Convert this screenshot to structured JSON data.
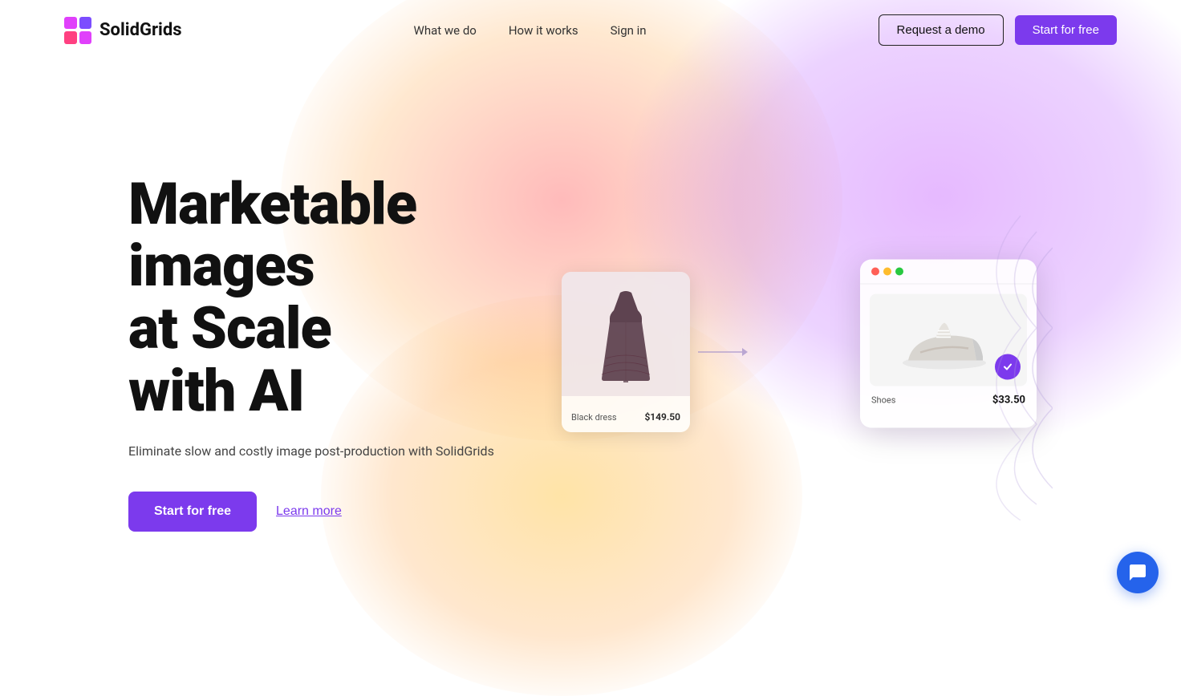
{
  "nav": {
    "logo_text_bold": "Solid",
    "logo_text_light": "Grids",
    "links": [
      {
        "id": "what-we-do",
        "label": "What we do"
      },
      {
        "id": "how-it-works",
        "label": "How it works"
      },
      {
        "id": "sign-in",
        "label": "Sign in"
      }
    ],
    "btn_demo": "Request a demo",
    "btn_start": "Start for free"
  },
  "hero": {
    "title_line1": "Marketable",
    "title_line2": "images",
    "title_line3": "at Scale",
    "title_line4": "with AI",
    "subtitle": "Eliminate slow and costly image post-production with SolidGrids",
    "btn_start": "Start for free",
    "btn_learn": "Learn more"
  },
  "product_cards": {
    "dress": {
      "label": "Black dress",
      "price": "$149.50"
    },
    "shoe": {
      "label": "Shoes",
      "price": "$33.50"
    }
  },
  "chat": {
    "icon": "💬"
  }
}
